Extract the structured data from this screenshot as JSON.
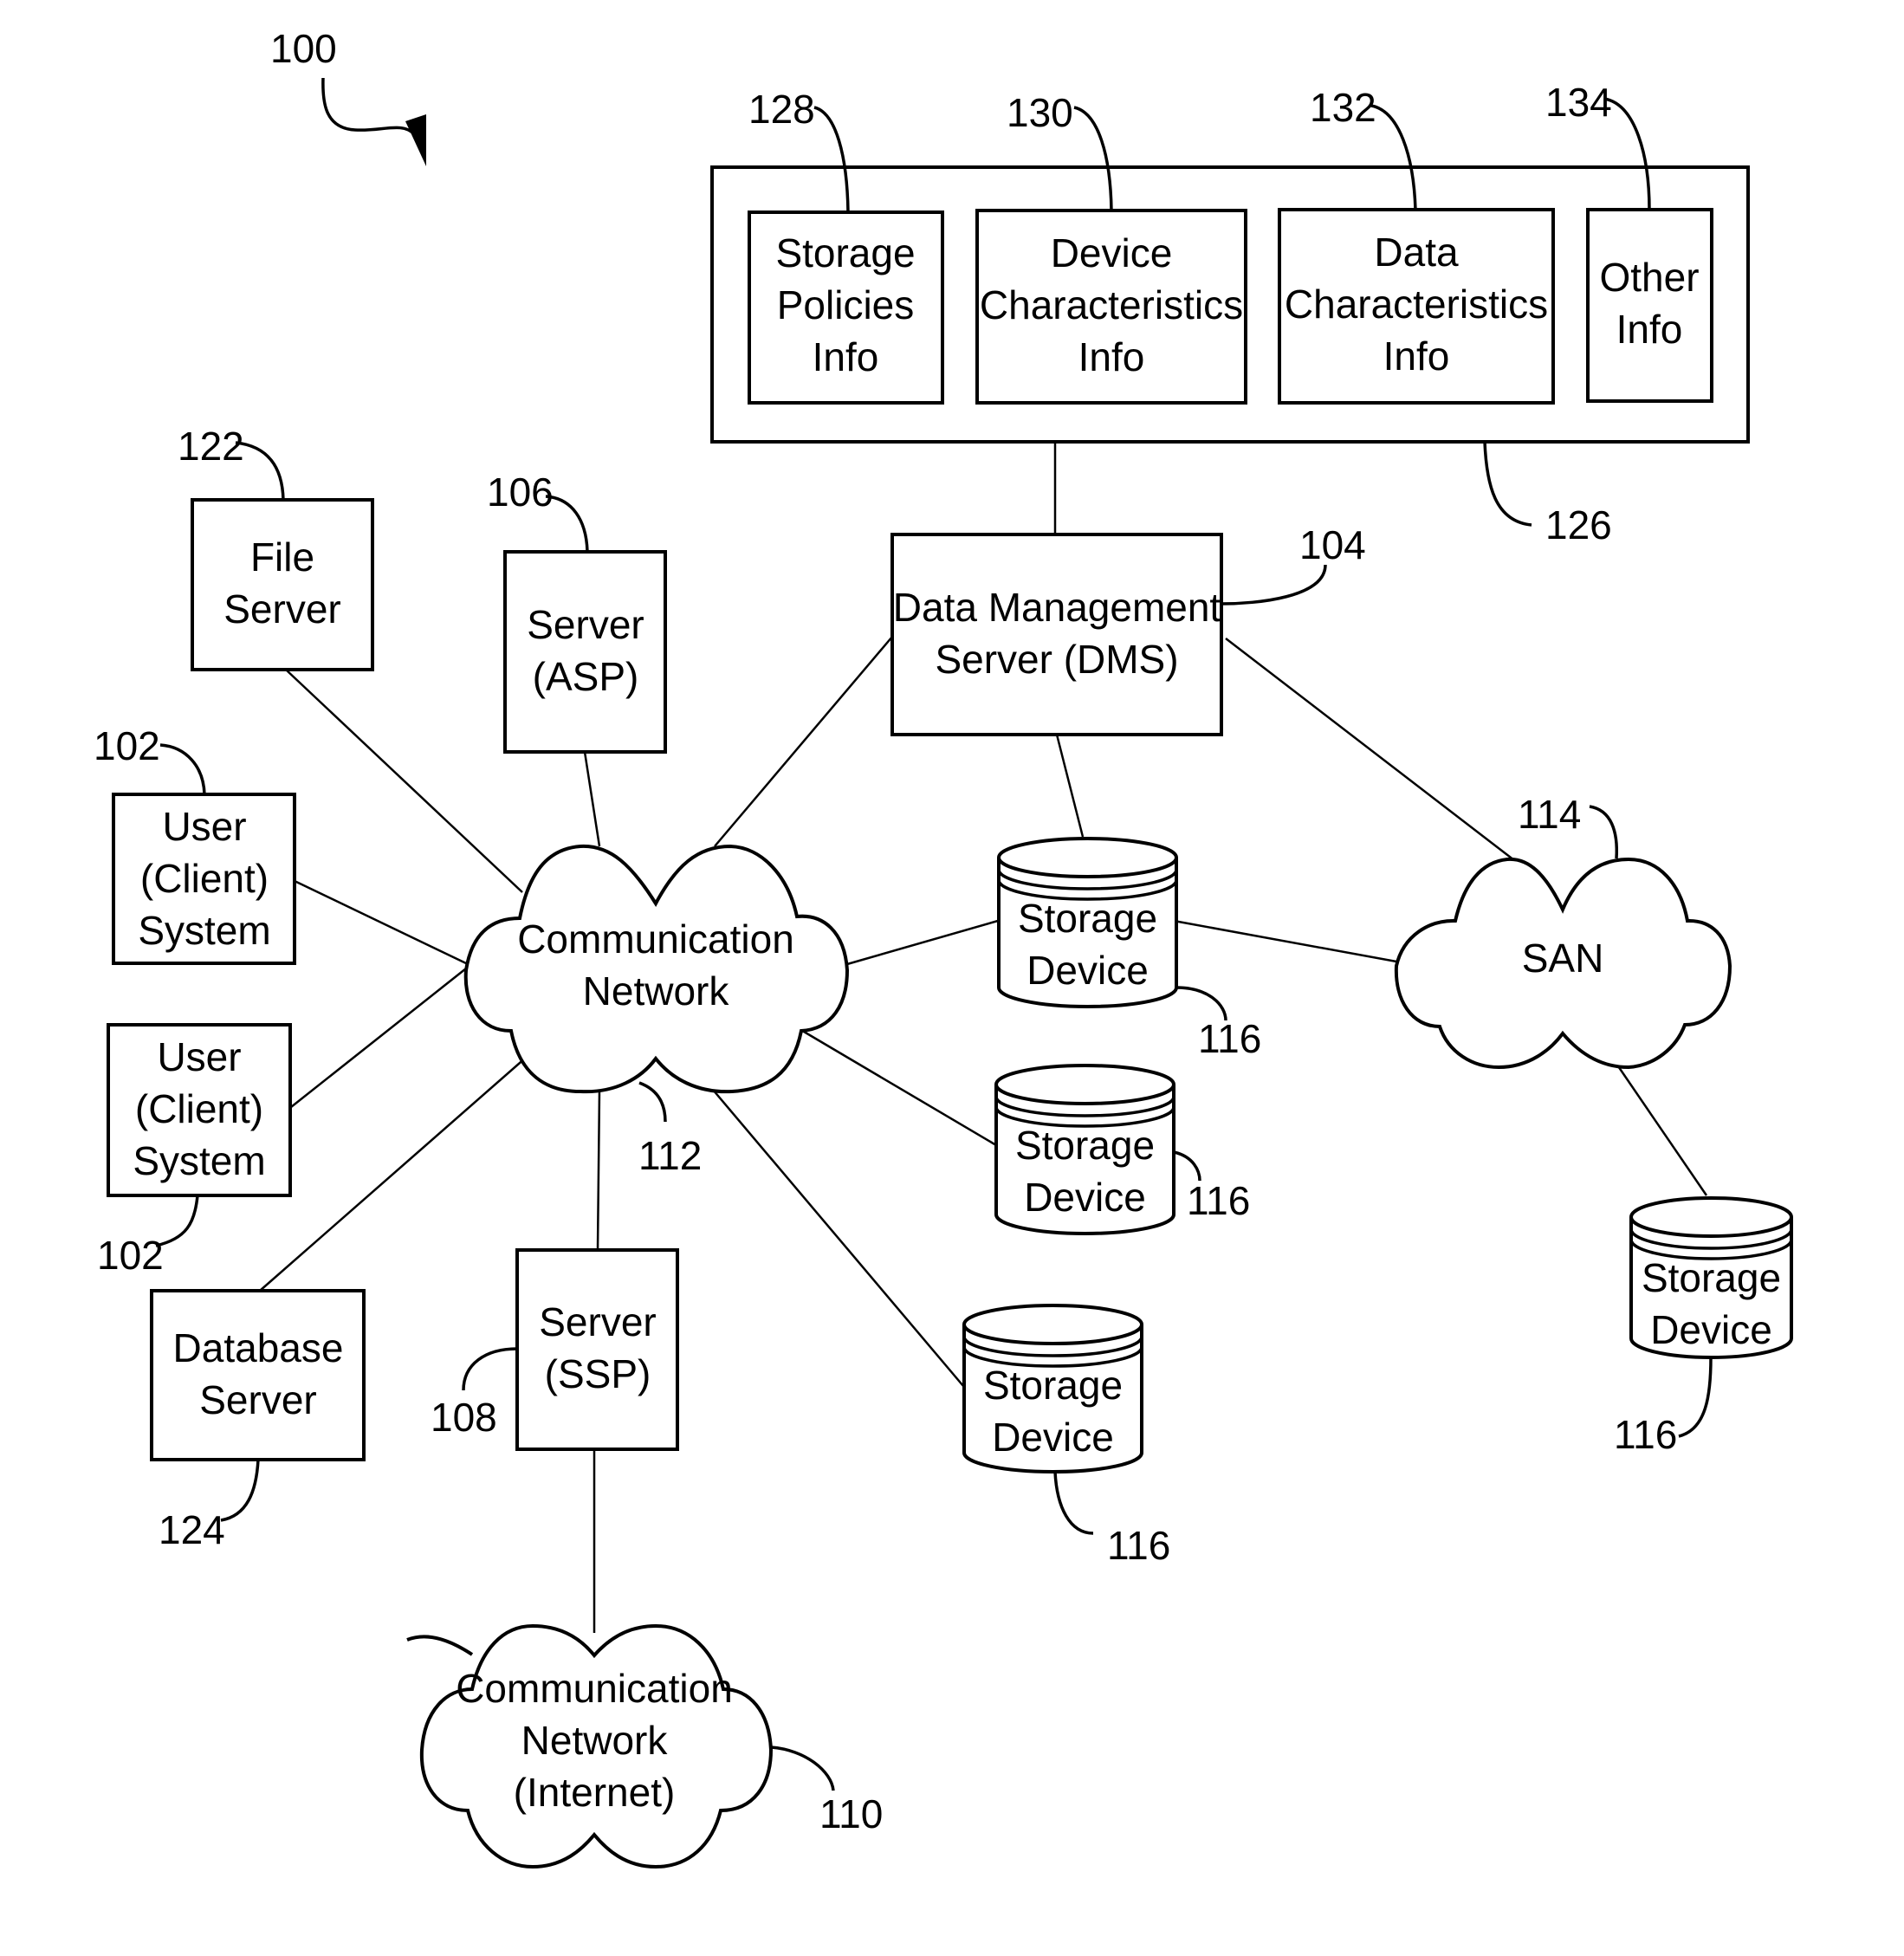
{
  "figure": {
    "ref": "100",
    "info_store": {
      "ref": "126",
      "items": [
        {
          "ref": "128",
          "lines": [
            "Storage",
            "Policies",
            "Info"
          ]
        },
        {
          "ref": "130",
          "lines": [
            "Device",
            "Characteristics",
            "Info"
          ]
        },
        {
          "ref": "132",
          "lines": [
            "Data",
            "Characteristics",
            "Info"
          ]
        },
        {
          "ref": "134",
          "lines": [
            "Other",
            "Info"
          ]
        }
      ]
    },
    "dms": {
      "ref": "104",
      "lines": [
        "Data Management",
        "Server (DMS)"
      ]
    },
    "file_server": {
      "ref": "122",
      "lines": [
        "File",
        "Server"
      ]
    },
    "asp_server": {
      "ref": "106",
      "lines": [
        "Server",
        "(ASP)"
      ]
    },
    "user_client_1": {
      "ref": "102",
      "lines": [
        "User",
        "(Client)",
        "System"
      ]
    },
    "user_client_2": {
      "ref": "102",
      "lines": [
        "User",
        "(Client)",
        "System"
      ]
    },
    "database_server": {
      "ref": "124",
      "lines": [
        "Database",
        "Server"
      ]
    },
    "ssp_server": {
      "ref": "108",
      "lines": [
        "Server",
        "(SSP)"
      ]
    },
    "comm_network": {
      "ref": "112",
      "lines": [
        "Communication",
        "Network"
      ]
    },
    "san": {
      "ref": "114",
      "lines": [
        "SAN"
      ]
    },
    "internet": {
      "ref": "110",
      "lines": [
        "Communication",
        "Network",
        "(Internet)"
      ]
    },
    "storage_devices": [
      {
        "ref": "116",
        "lines": [
          "Storage",
          "Device"
        ]
      },
      {
        "ref": "116",
        "lines": [
          "Storage",
          "Device"
        ]
      },
      {
        "ref": "116",
        "lines": [
          "Storage",
          "Device"
        ]
      },
      {
        "ref": "116",
        "lines": [
          "Storage",
          "Device"
        ]
      }
    ]
  }
}
